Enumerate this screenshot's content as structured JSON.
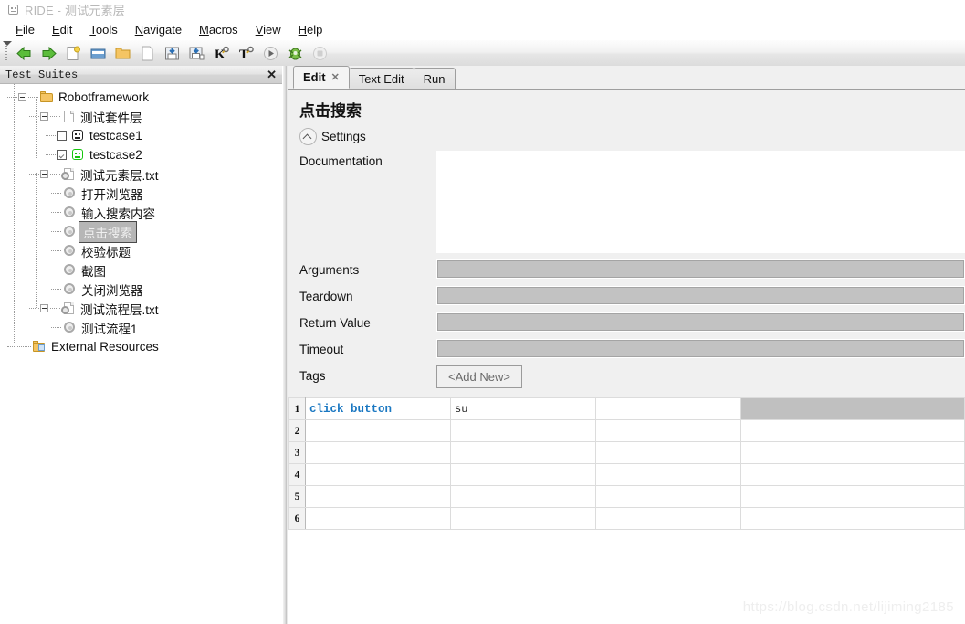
{
  "window": {
    "title": "RIDE - 测试元素层",
    "icon": "robot-icon"
  },
  "menubar": {
    "items": [
      {
        "label": "File",
        "mnemonic": "F"
      },
      {
        "label": "Edit",
        "mnemonic": "E"
      },
      {
        "label": "Tools",
        "mnemonic": "T"
      },
      {
        "label": "Navigate",
        "mnemonic": "N"
      },
      {
        "label": "Macros",
        "mnemonic": "M"
      },
      {
        "label": "View",
        "mnemonic": "V"
      },
      {
        "label": "Help",
        "mnemonic": "H"
      }
    ]
  },
  "toolbar": {
    "buttons": [
      {
        "name": "back-icon",
        "glyph": "◀"
      },
      {
        "name": "forward-icon",
        "glyph": "▶"
      },
      {
        "name": "new-project-icon",
        "glyph": "▯"
      },
      {
        "name": "open-folder-icon",
        "glyph": "▤"
      },
      {
        "name": "folder-icon",
        "glyph": "▬"
      },
      {
        "name": "new-file-icon",
        "glyph": "▯"
      },
      {
        "name": "save-icon",
        "glyph": "▣"
      },
      {
        "name": "save-all-icon",
        "glyph": "▣"
      },
      {
        "name": "search-keyword-icon",
        "glyph": "K"
      },
      {
        "name": "search-tests-icon",
        "glyph": "T"
      },
      {
        "name": "run-icon",
        "glyph": "▶"
      },
      {
        "name": "debug-icon",
        "glyph": "✺"
      },
      {
        "name": "stop-icon",
        "glyph": "●"
      }
    ]
  },
  "tree_panel": {
    "header": "Test Suites",
    "close": "✕",
    "nodes": [
      {
        "label": "Robotframework",
        "icon": "folder-icon",
        "depth": 0,
        "toggle": "minus",
        "checkbox": "none",
        "selected": false
      },
      {
        "label": "测试套件层",
        "icon": "document-icon",
        "depth": 1,
        "toggle": "minus",
        "checkbox": "none",
        "selected": false
      },
      {
        "label": "testcase1",
        "icon": "robot-icon",
        "depth": 2,
        "toggle": "none",
        "checkbox": "off",
        "selected": false
      },
      {
        "label": "testcase2",
        "icon": "robot-green-icon",
        "depth": 2,
        "toggle": "none",
        "checkbox": "on",
        "selected": false
      },
      {
        "label": "测试元素层.txt",
        "icon": "resource-icon",
        "depth": 1,
        "toggle": "minus",
        "checkbox": "none",
        "selected": false
      },
      {
        "label": "打开浏览器",
        "icon": "gear-icon",
        "depth": 2,
        "toggle": "none",
        "checkbox": "none",
        "selected": false
      },
      {
        "label": "输入搜索内容",
        "icon": "gear-icon",
        "depth": 2,
        "toggle": "none",
        "checkbox": "none",
        "selected": false
      },
      {
        "label": "点击搜索",
        "icon": "gear-icon",
        "depth": 2,
        "toggle": "none",
        "checkbox": "none",
        "selected": true
      },
      {
        "label": "校验标题",
        "icon": "gear-icon",
        "depth": 2,
        "toggle": "none",
        "checkbox": "none",
        "selected": false
      },
      {
        "label": "截图",
        "icon": "gear-icon",
        "depth": 2,
        "toggle": "none",
        "checkbox": "none",
        "selected": false
      },
      {
        "label": "关闭浏览器",
        "icon": "gear-icon",
        "depth": 2,
        "toggle": "none",
        "checkbox": "none",
        "selected": false
      },
      {
        "label": "测试流程层.txt",
        "icon": "resource-icon",
        "depth": 1,
        "toggle": "minus",
        "checkbox": "none",
        "selected": false
      },
      {
        "label": "测试流程1",
        "icon": "gear-icon",
        "depth": 2,
        "toggle": "none",
        "checkbox": "none",
        "selected": false
      },
      {
        "label": "External Resources",
        "icon": "external-resources-icon",
        "depth": 0,
        "toggle": "none",
        "checkbox": "none",
        "selected": false
      }
    ]
  },
  "editor": {
    "tabs": [
      {
        "label": "Edit",
        "active": true,
        "closable": true,
        "close_glyph": "✕"
      },
      {
        "label": "Text Edit",
        "active": false,
        "closable": false
      },
      {
        "label": "Run",
        "active": false,
        "closable": false
      }
    ],
    "keyword_title": "点击搜索",
    "settings": {
      "label": "Settings",
      "expanded": true,
      "fields": [
        {
          "label": "Documentation",
          "type": "textarea",
          "value": ""
        },
        {
          "label": "Arguments",
          "type": "text",
          "value": ""
        },
        {
          "label": "Teardown",
          "type": "text",
          "value": ""
        },
        {
          "label": "Return Value",
          "type": "text",
          "value": ""
        },
        {
          "label": "Timeout",
          "type": "text",
          "value": ""
        },
        {
          "label": "Tags",
          "type": "button",
          "value": "<Add New>"
        }
      ]
    },
    "grid": {
      "rows": [
        {
          "number": "1",
          "cells": [
            "click button",
            "su",
            "",
            "",
            ""
          ],
          "cell_styles": [
            "kw",
            "arg",
            "",
            "shaded",
            "shaded"
          ]
        },
        {
          "number": "2",
          "cells": [
            "",
            "",
            "",
            "",
            ""
          ],
          "cell_styles": [
            "",
            "",
            "",
            "",
            ""
          ]
        },
        {
          "number": "3",
          "cells": [
            "",
            "",
            "",
            "",
            ""
          ],
          "cell_styles": [
            "",
            "",
            "",
            "",
            ""
          ]
        },
        {
          "number": "4",
          "cells": [
            "",
            "",
            "",
            "",
            ""
          ],
          "cell_styles": [
            "",
            "",
            "",
            "",
            ""
          ]
        },
        {
          "number": "5",
          "cells": [
            "",
            "",
            "",
            "",
            ""
          ],
          "cell_styles": [
            "",
            "",
            "",
            "",
            ""
          ]
        },
        {
          "number": "6",
          "cells": [
            "",
            "",
            "",
            "",
            ""
          ],
          "cell_styles": [
            "",
            "",
            "",
            "",
            ""
          ]
        }
      ]
    }
  },
  "watermark": "https://blog.csdn.net/lijiming2185",
  "colors": {
    "keyword_blue": "#1b78c2",
    "robot_green": "#16c60c",
    "folder_yellow": "#f5c563",
    "shaded_cell": "#c0c0c0",
    "panel_bg": "#f0f0f0"
  }
}
